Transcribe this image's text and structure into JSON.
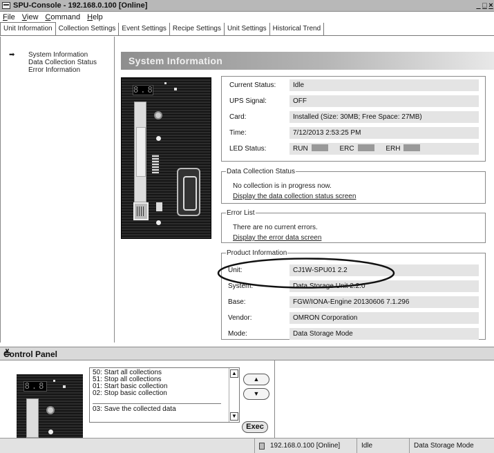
{
  "window": {
    "title": "SPU-Console - 192.168.0.100 [Online]",
    "controls": [
      "_",
      "□",
      "×"
    ]
  },
  "menu": [
    "File",
    "View",
    "Command",
    "Help"
  ],
  "tabs": [
    "Unit Information",
    "Collection Settings",
    "Event Settings",
    "Recipe Settings",
    "Unit Settings",
    "Historical Trend"
  ],
  "sidebar": {
    "items": [
      "System Information",
      "Data Collection Status",
      "Error Information"
    ],
    "selected_marker": "➡"
  },
  "header": {
    "title": "System Information"
  },
  "device": {
    "display": "8.8"
  },
  "status": {
    "current_status_label": "Current Status:",
    "current_status": "Idle",
    "ups_label": "UPS Signal:",
    "ups": "OFF",
    "card_label": "Card:",
    "card": "Installed  (Size: 30MB; Free Space: 27MB)",
    "time_label": "Time:",
    "time": "7/12/2013 2:53:25 PM",
    "led_label": "LED Status:",
    "led_run": "RUN",
    "led_erc": "ERC",
    "led_erh": "ERH"
  },
  "data_collection": {
    "legend": "Data Collection Status",
    "text": "No collection is in progress now.",
    "link": "Display the data collection status screen"
  },
  "error_list": {
    "legend": "Error List",
    "text": "There are no current errors.",
    "link": "Display the error data screen"
  },
  "product": {
    "legend": "Product Information",
    "unit_label": "Unit:",
    "unit": "CJ1W-SPU01          2.2",
    "system_label": "System:",
    "system": "Data Storage Unit  2.2.0",
    "base_label": "Base:",
    "base": "FGW/IONA-Engine 20130606  7.1.296",
    "vendor_label": "Vendor:",
    "vendor": "OMRON Corporation",
    "mode_label": "Mode:",
    "mode": "Data Storage Mode"
  },
  "control_panel": {
    "title": "Control Panel",
    "collapse_icon": "≚",
    "commands": [
      "50: Start all collections",
      "51: Stop all collections",
      "01: Start basic collection",
      "02: Stop basic collection"
    ],
    "selected_command": "03: Save the collected data",
    "up_label": "▲",
    "down_label": "▼",
    "exec_label": "Exec"
  },
  "statusbar": {
    "connection": "192.168.0.100 [Online]",
    "state": "Idle",
    "mode": "Data Storage Mode"
  },
  "colors": {
    "title_bar": "#b8b8b8",
    "value_field": "#e4e4e4",
    "led_off": "#999999",
    "header_gradient_start": "#8e8e8e"
  }
}
